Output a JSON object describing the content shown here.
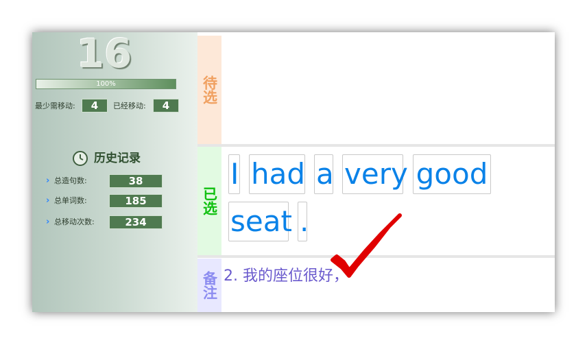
{
  "status": {
    "big_number": "16",
    "progress": {
      "percent": 100,
      "label": "100%"
    },
    "min_moves_label": "最少需移动:",
    "min_moves_value": "4",
    "moved_label": "已经移动:",
    "moved_value": "4"
  },
  "history": {
    "title": "历史记录",
    "icon": "clock-icon",
    "items": [
      {
        "label": "总造句数:",
        "value": "38"
      },
      {
        "label": "总单词数:",
        "value": "185"
      },
      {
        "label": "总移动次数:",
        "value": "234"
      }
    ]
  },
  "sections": {
    "pending_label": "待选",
    "selected_label": "已选",
    "note_label": "备注"
  },
  "selected_words": [
    "I",
    "had",
    "a",
    "very",
    "good",
    "seat",
    "."
  ],
  "note": {
    "text": "2. 我的座位很好，"
  },
  "colors": {
    "word_text": "#0a82e8",
    "note_text": "#6a5acd",
    "pending_tag": "#f0a060",
    "selected_tag": "#10c010",
    "note_tag": "#8c8cf0",
    "checkmark": "#e00000",
    "value_box": "#4f7a50"
  }
}
